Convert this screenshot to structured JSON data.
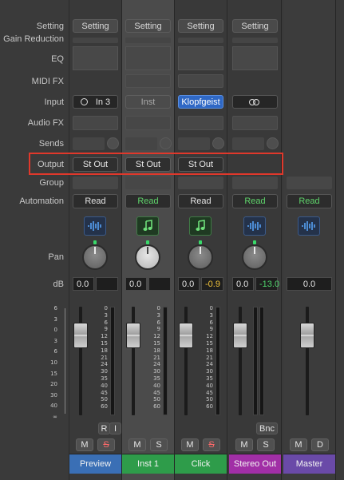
{
  "labels": {
    "setting": "Setting",
    "gain_reduction": "Gain Reduction",
    "eq": "EQ",
    "midi_fx": "MIDI FX",
    "input": "Input",
    "audio_fx": "Audio FX",
    "sends": "Sends",
    "output": "Output",
    "group": "Group",
    "automation": "Automation",
    "pan": "Pan",
    "db": "dB"
  },
  "meter_scale": [
    "0",
    "3",
    "6",
    "9",
    "12",
    "15",
    "18",
    "21",
    "24",
    "30",
    "35",
    "40",
    "45",
    "50",
    "60"
  ],
  "fader_scale": [
    "6",
    "3",
    "0",
    "3",
    "6",
    "10",
    "15",
    "20",
    "30",
    "40",
    "∞"
  ],
  "strips": [
    {
      "name": "Preview",
      "color": "#3a6fb5",
      "setting": "Setting",
      "input": "In 3",
      "output": "St Out",
      "automation": "Read",
      "automation_color": "#e4e4e4",
      "icon": "audio-waveform-icon",
      "db": "0.0",
      "peak": "",
      "r_label": "R",
      "i_label": "I",
      "m": "M",
      "s": "S"
    },
    {
      "name": "Inst 1",
      "color": "#2e9c4a",
      "setting": "Setting",
      "input": "Inst",
      "output": "St Out",
      "automation": "Read",
      "automation_color": "#5fd46b",
      "icon": "music-note-icon",
      "db": "0.0",
      "peak": "",
      "m": "M",
      "s": "S"
    },
    {
      "name": "Click",
      "color": "#2e9c4a",
      "setting": "Setting",
      "input": "Klopfgeist",
      "output": "St Out",
      "automation": "Read",
      "automation_color": "#e4e4e4",
      "icon": "music-note-icon",
      "db": "0.0",
      "peak": "-0.9",
      "m": "M",
      "s": "S"
    },
    {
      "name": "Stereo Out",
      "color": "#a12fa6",
      "setting": "Setting",
      "input": "",
      "output": "",
      "automation": "Read",
      "automation_color": "#5fd46b",
      "icon": "audio-waveform-icon",
      "db": "0.0",
      "peak": "-13.0",
      "bnc": "Bnc",
      "m": "M",
      "s": "S"
    },
    {
      "name": "Master",
      "color": "#6a4aa8",
      "automation": "Read",
      "automation_color": "#5fd46b",
      "icon": "audio-waveform-icon",
      "db": "0.0",
      "m": "M",
      "d": "D"
    }
  ]
}
